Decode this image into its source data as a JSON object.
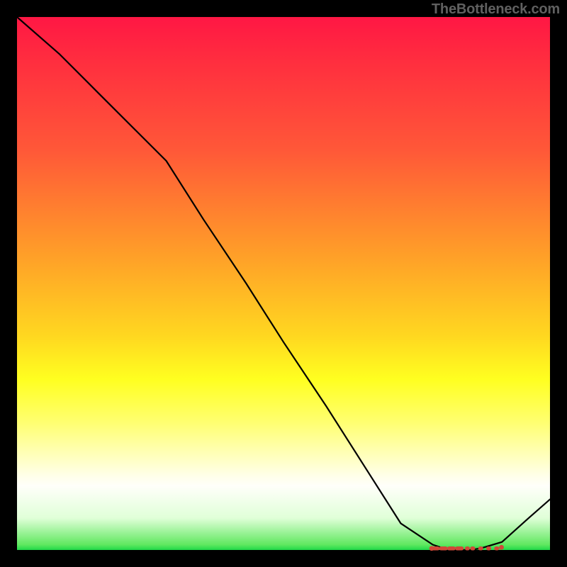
{
  "watermark": "TheBottleneck.com",
  "colors": {
    "line": "#000000",
    "marker": "#d04838",
    "background": "#000000"
  },
  "chart_data": {
    "type": "line",
    "title": "",
    "xlabel": "",
    "ylabel": "",
    "xlim": [
      0,
      100
    ],
    "ylim": [
      0,
      100
    ],
    "x": [
      0,
      8,
      15,
      22,
      28,
      35,
      43,
      50,
      58,
      65,
      72,
      78,
      80,
      82,
      84,
      85,
      87,
      91,
      96,
      100
    ],
    "values": [
      100,
      93,
      86,
      79,
      73,
      62,
      50,
      39,
      27,
      16,
      5,
      1,
      0.3,
      0,
      0,
      0,
      0.3,
      1.5,
      6,
      9.5
    ],
    "markers_x": [
      78.5,
      80,
      81.5,
      83,
      84.5,
      85.5,
      87.0,
      88.5,
      90.0
    ]
  }
}
